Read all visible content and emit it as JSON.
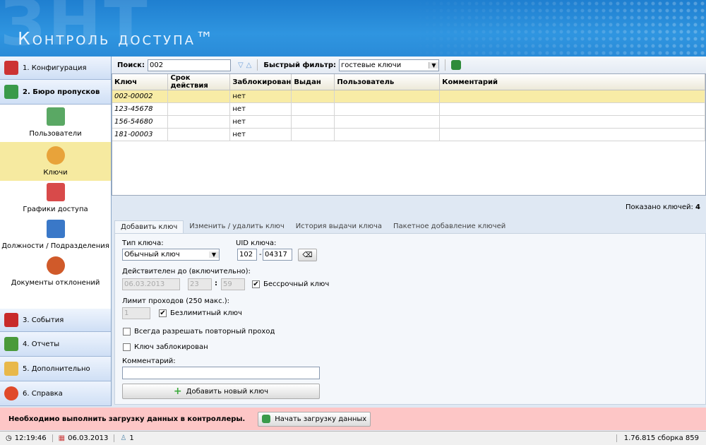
{
  "header": {
    "logo": "ЗНТ",
    "title": "Контроль доступа™"
  },
  "sidebar": {
    "sections": [
      {
        "label": "1. Конфигурация",
        "icon": "wrench-icon"
      },
      {
        "label": "2. Бюро пропусков",
        "icon": "id-card-icon"
      },
      {
        "label": "3. События",
        "icon": "journal-icon"
      },
      {
        "label": "4. Отчеты",
        "icon": "chart-icon"
      },
      {
        "label": "5. Дополнительно",
        "icon": "envelope-icon"
      },
      {
        "label": "6. Справка",
        "icon": "help-icon"
      }
    ],
    "subitems": [
      {
        "label": "Пользователи",
        "icon": "users-icon"
      },
      {
        "label": "Ключи",
        "icon": "key-icon"
      },
      {
        "label": "Графики доступа",
        "icon": "calendar-icon"
      },
      {
        "label": "Должности / Подразделения",
        "icon": "org-chart-icon"
      },
      {
        "label": "Документы отклонений",
        "icon": "alarm-clock-icon"
      }
    ]
  },
  "toolbar": {
    "search_label": "Поиск:",
    "search_value": "002",
    "filter_label": "Быстрый фильтр:",
    "filter_value": "гостевые ключи"
  },
  "table": {
    "columns": [
      "Ключ",
      "Срок действия",
      "Заблокирован",
      "Выдан",
      "Пользователь",
      "Комментарий"
    ],
    "rows": [
      [
        "002-00002",
        "",
        "нет",
        "",
        "",
        ""
      ],
      [
        "123-45678",
        "",
        "нет",
        "",
        "",
        ""
      ],
      [
        "156-54680",
        "",
        "нет",
        "",
        "",
        ""
      ],
      [
        "181-00003",
        "",
        "нет",
        "",
        "",
        ""
      ]
    ]
  },
  "count": {
    "label": "Показано ключей:",
    "value": "4"
  },
  "tabs": [
    "Добавить ключ",
    "Изменить / удалить ключ",
    "История выдачи ключа",
    "Пакетное добавление ключей"
  ],
  "form": {
    "key_type_label": "Тип ключа:",
    "key_type_value": "Обычный ключ",
    "uid_label": "UID ключа:",
    "uid_part1": "102",
    "uid_sep": "-",
    "uid_part2": "04317",
    "valid_label": "Действителен до (включительно):",
    "date": "06.03.2013",
    "hour": "23",
    "minute": "59",
    "time_sep": ":",
    "unlimited_time_label": "Бессрочный ключ",
    "unlimited_time_checked": true,
    "limit_label": "Лимит проходов (250 макс.):",
    "limit_value": "1",
    "unlimited_label": "Безлимитный ключ",
    "unlimited_checked": true,
    "repeat_label": "Всегда разрешать повторный проход",
    "repeat_checked": false,
    "blocked_label": "Ключ заблокирован",
    "blocked_checked": false,
    "comment_label": "Комментарий:",
    "comment_value": "",
    "add_button": "Добавить новый ключ"
  },
  "alert": {
    "message": "Необходимо выполнить загрузку данных в контроллеры.",
    "button": "Начать загрузку данных",
    "color": "#fdc6c6"
  },
  "status": {
    "time": "12:19:46",
    "date": "06.03.2013",
    "users": "1",
    "version": "1.76.815 сборка 859"
  }
}
